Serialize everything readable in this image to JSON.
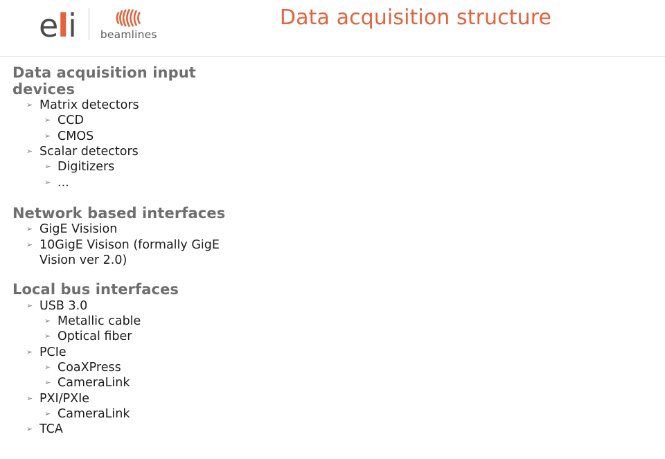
{
  "header": {
    "title": "Data acquisition structure",
    "logo": {
      "wordmark_e": "e",
      "wordmark_l": "l",
      "wordmark_i": "i",
      "beamlines_label": "beamlines"
    }
  },
  "colors": {
    "title_orange": "#e2633c",
    "heading_gray": "#6e6e6e",
    "body_text": "#1c1c1c",
    "bullet_gray": "#7d7d7d",
    "rule": "#e9e9e9",
    "logo_dark": "#4c4c4c",
    "background": "#ffffff"
  },
  "bullet_glyph": "➢",
  "sections": [
    {
      "heading": "Data acquisition input devices",
      "items": [
        {
          "level": 1,
          "text": "Matrix detectors"
        },
        {
          "level": 2,
          "text": "CCD"
        },
        {
          "level": 2,
          "text": "CMOS"
        },
        {
          "level": 1,
          "text": "Scalar detectors"
        },
        {
          "level": 2,
          "text": "Digitizers"
        },
        {
          "level": 2,
          "text": "..."
        }
      ]
    },
    {
      "heading": "Network based interfaces",
      "items": [
        {
          "level": 1,
          "text": "GigE Visision"
        },
        {
          "level": 1,
          "text": "10GigE Visison (formally GigE Vision ver 2.0)"
        }
      ]
    },
    {
      "heading": "Local bus interfaces",
      "items": [
        {
          "level": 1,
          "text": "USB 3.0"
        },
        {
          "level": 2,
          "text": "Metallic cable"
        },
        {
          "level": 2,
          "text": "Optical fiber"
        },
        {
          "level": 1,
          "text": "PCIe"
        },
        {
          "level": 2,
          "text": "CoaXPress"
        },
        {
          "level": 2,
          "text": "CameraLink"
        },
        {
          "level": 1,
          "text": "PXI/PXIe"
        },
        {
          "level": 2,
          "text": "CameraLink"
        },
        {
          "level": 1,
          "text": "TCA"
        }
      ]
    }
  ]
}
